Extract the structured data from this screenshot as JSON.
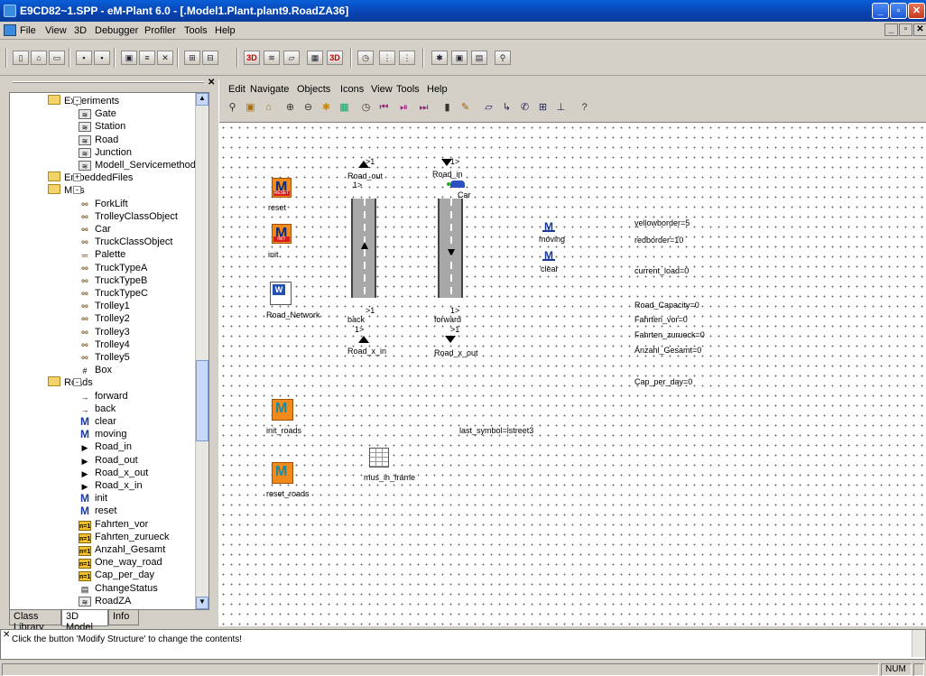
{
  "window": {
    "title": "E9CD82~1.SPP - eM-Plant 6.0 - [.Model1.Plant.plant9.RoadZA36]"
  },
  "menu": [
    "File",
    "View",
    "3D",
    "Debugger",
    "Profiler",
    "Tools",
    "Help"
  ],
  "model_menu": [
    "Edit",
    "Navigate",
    "Objects",
    "Icons",
    "View",
    "Tools",
    "Help"
  ],
  "tree": {
    "items": [
      {
        "label": "Experiments",
        "icon": "folder-icon",
        "level": 1,
        "exp": "-"
      },
      {
        "label": "Gate",
        "icon": "frame-icon",
        "level": 2
      },
      {
        "label": "Station",
        "icon": "frame-icon",
        "level": 2
      },
      {
        "label": "Road",
        "icon": "frame-icon",
        "level": 2
      },
      {
        "label": "Junction",
        "icon": "frame-icon",
        "level": 2
      },
      {
        "label": "Modell_Servicemethods",
        "icon": "frame-icon",
        "level": 2
      },
      {
        "label": "EmbeddedFiles",
        "icon": "folder-icon",
        "level": 1,
        "exp": "+"
      },
      {
        "label": "MUs",
        "icon": "folder-icon",
        "level": 1,
        "exp": "-"
      },
      {
        "label": "ForkLift",
        "icon": "trolley-icon",
        "level": 2
      },
      {
        "label": "TrolleyClassObject",
        "icon": "trolley-icon",
        "level": 2
      },
      {
        "label": "Car",
        "icon": "trolley-icon",
        "level": 2
      },
      {
        "label": "TruckClassObject",
        "icon": "trolley-icon",
        "level": 2
      },
      {
        "label": "Palette",
        "icon": "palette-icon",
        "level": 2
      },
      {
        "label": "TruckTypeA",
        "icon": "trolley-icon",
        "level": 2
      },
      {
        "label": "TruckTypeB",
        "icon": "trolley-icon",
        "level": 2
      },
      {
        "label": "TruckTypeC",
        "icon": "trolley-icon",
        "level": 2
      },
      {
        "label": "Trolley1",
        "icon": "trolley-icon",
        "level": 2
      },
      {
        "label": "Trolley2",
        "icon": "trolley-icon",
        "level": 2
      },
      {
        "label": "Trolley3",
        "icon": "trolley-icon",
        "level": 2
      },
      {
        "label": "Trolley4",
        "icon": "trolley-icon",
        "level": 2
      },
      {
        "label": "Trolley5",
        "icon": "trolley-icon",
        "level": 2
      },
      {
        "label": "Box",
        "icon": "box-icon",
        "level": 2
      },
      {
        "label": "Roads",
        "icon": "folder-icon",
        "level": 1,
        "exp": "-"
      },
      {
        "label": "forward",
        "icon": "connector-icon",
        "level": 2
      },
      {
        "label": "back",
        "icon": "connector-icon",
        "level": 2
      },
      {
        "label": "clear",
        "icon": "method-icon",
        "level": 2
      },
      {
        "label": "moving",
        "icon": "method-icon",
        "level": 2
      },
      {
        "label": "Road_in",
        "icon": "interface-icon",
        "level": 2
      },
      {
        "label": "Road_out",
        "icon": "interface-icon",
        "level": 2
      },
      {
        "label": "Road_x_out",
        "icon": "interface-icon",
        "level": 2
      },
      {
        "label": "Road_x_in",
        "icon": "interface-icon",
        "level": 2
      },
      {
        "label": "init",
        "icon": "method-icon",
        "level": 2
      },
      {
        "label": "reset",
        "icon": "method-icon",
        "level": 2
      },
      {
        "label": "Fahrten_vor",
        "icon": "variable-icon",
        "level": 2
      },
      {
        "label": "Fahrten_zurueck",
        "icon": "variable-icon",
        "level": 2
      },
      {
        "label": "Anzahl_Gesamt",
        "icon": "variable-icon",
        "level": 2
      },
      {
        "label": "One_way_road",
        "icon": "variable-icon",
        "level": 2
      },
      {
        "label": "Cap_per_day",
        "icon": "variable-icon",
        "level": 2
      },
      {
        "label": "ChangeStatus",
        "icon": "generator-icon",
        "level": 2
      },
      {
        "label": "RoadZA",
        "icon": "frame-icon",
        "level": 2
      }
    ]
  },
  "tabs": [
    "Class Library",
    "3D Model",
    "Info"
  ],
  "canvas": {
    "reset": "reset",
    "init": "init",
    "road_network": "Road_Network",
    "init_roads": "init_roads",
    "reset_roads": "reset_roads",
    "mus_in_frame": "mus_in_frame",
    "road_out": "Road_out",
    "road_in": "Road_in",
    "back": "back",
    "forward": "forward",
    "road_x_in": "Road_x_in",
    "road_x_out": "Road_x_out",
    "car": "Car",
    "moving": "moving",
    "clear": "clear",
    "last_symbol": "last_symbol=lstreet3",
    "p1": ">1",
    "p2": "1>",
    "vars": [
      "yellowborder=5",
      "redborder=10",
      "current_load=0",
      "Road_Capacity=0",
      "Fahrten_vor=0",
      "Fahrten_zurueck=0",
      "Anzahl_Gesamt=0",
      "Cap_per_day=0"
    ]
  },
  "status_message": "Click the button 'Modify Structure' to change the contents!",
  "statusbar": {
    "num": "NUM"
  }
}
